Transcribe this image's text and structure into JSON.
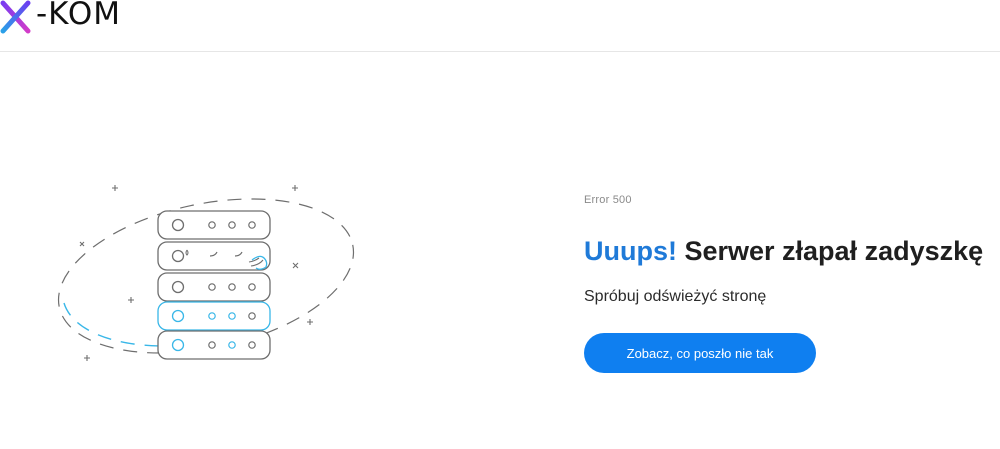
{
  "header": {
    "logo_text": "-KOM",
    "logo_letter": "x"
  },
  "error": {
    "code_label": "Error 500",
    "headline_accent": "Uuups!",
    "headline_rest": " Serwer złapał zadyszkę",
    "subtitle": "Spróbuj odświeżyć stronę",
    "cta_label": "Zobacz, co poszło nie tak"
  },
  "colors": {
    "accent": "#1f7ad8",
    "button": "#0f7ff0",
    "illustration_gray": "#6e6e6e",
    "illustration_blue": "#39b7e8"
  },
  "icons": {
    "illustration": "server-rack-illustration",
    "logo": "x-kom-logo"
  }
}
